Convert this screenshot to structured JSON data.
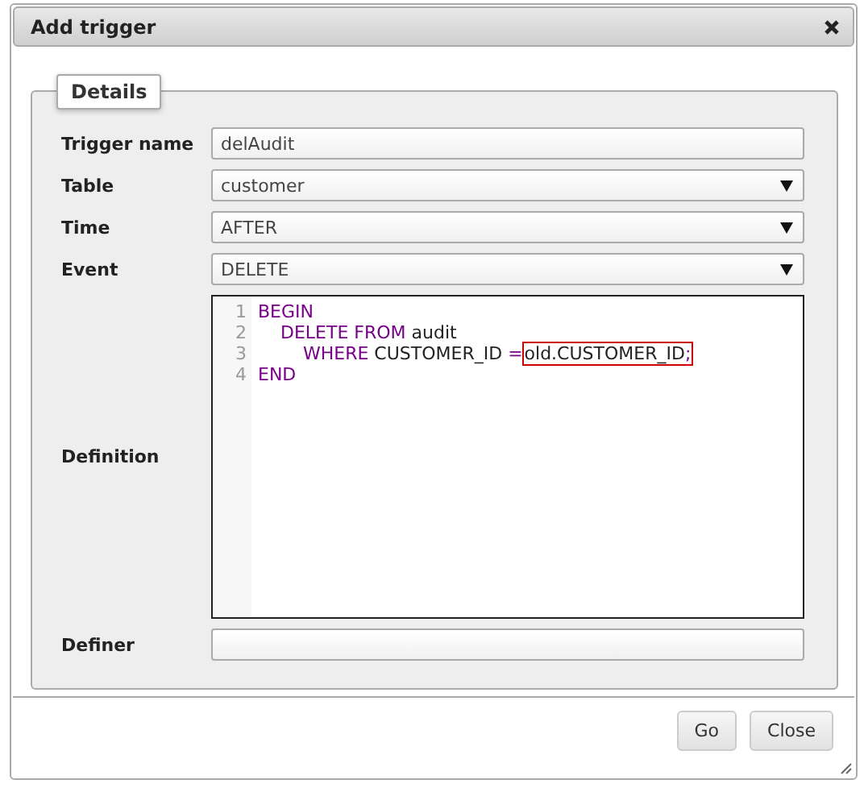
{
  "window": {
    "title": "Add trigger"
  },
  "fieldset": {
    "legend": "Details"
  },
  "fields": [
    {
      "label": "Trigger name",
      "kind": "text",
      "value": "delAudit"
    },
    {
      "label": "Table",
      "kind": "select",
      "value": "customer"
    },
    {
      "label": "Time",
      "kind": "select",
      "value": "AFTER"
    },
    {
      "label": "Event",
      "kind": "select",
      "value": "DELETE"
    },
    {
      "label": "Definition",
      "kind": "code",
      "lines": [
        {
          "number": "1",
          "tokens": [
            {
              "text": "BEGIN",
              "kind": "keyword"
            }
          ]
        },
        {
          "number": "2",
          "tokens": [
            {
              "text": "    DELETE FROM",
              "kind": "keyword"
            },
            {
              "text": " audit",
              "kind": "plain"
            }
          ]
        },
        {
          "number": "3",
          "tokens": [
            {
              "text": "        WHERE",
              "kind": "keyword"
            },
            {
              "text": " CUSTOMER_ID ",
              "kind": "plain"
            },
            {
              "text": "=",
              "kind": "keyword"
            }
          ],
          "highlight": [
            {
              "text": "old.CUSTOMER_ID",
              "kind": "plain"
            },
            {
              "text": ";",
              "kind": "keyword"
            }
          ]
        },
        {
          "number": "4",
          "tokens": [
            {
              "text": "END",
              "kind": "keyword"
            }
          ]
        }
      ]
    },
    {
      "label": "Definer",
      "kind": "text"
    }
  ],
  "buttons": [
    "Go",
    "Close"
  ]
}
